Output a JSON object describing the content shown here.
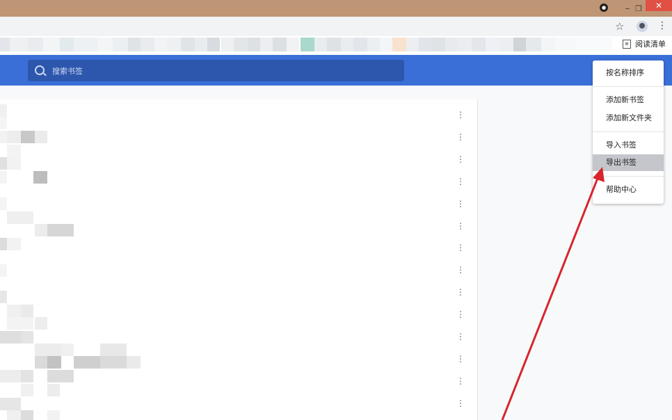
{
  "titlebar": {
    "profile_badge": "●",
    "restore_glyph": "❐",
    "close_glyph": "✕"
  },
  "toolbar": {
    "star_glyph": "☆",
    "menu_glyph": "⋮"
  },
  "bookmarks_bar": {
    "reading_list_label": "阅读清单",
    "reading_list_icon": "list-icon"
  },
  "header": {
    "search_placeholder": "搜索书签",
    "color": "#3b6fd8"
  },
  "rows": {
    "row_menu_glyph": "⋮",
    "count": 14
  },
  "menu": {
    "items": [
      {
        "label": "按名称排序"
      },
      {
        "label": "添加新书签"
      },
      {
        "label": "添加新文件夹"
      },
      {
        "label": "导入书签"
      },
      {
        "label": "导出书签",
        "highlighted": true
      },
      {
        "label": "帮助中心"
      }
    ]
  },
  "annotation": {
    "arrow_color": "#d8242c"
  }
}
